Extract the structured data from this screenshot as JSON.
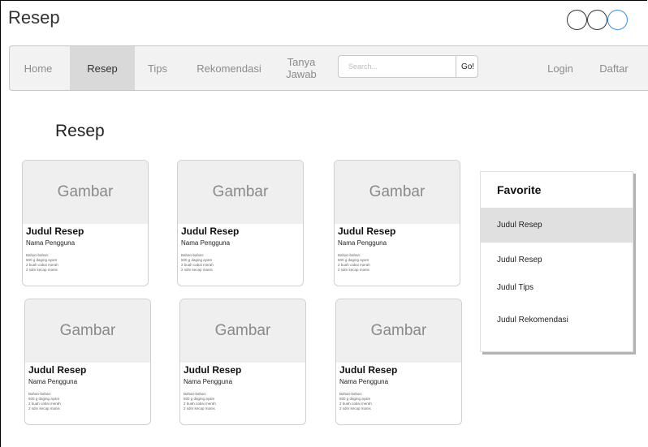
{
  "app": {
    "title": "Resep"
  },
  "nav": {
    "items": [
      {
        "label": "Home"
      },
      {
        "label": "Resep"
      },
      {
        "label": "Tips"
      },
      {
        "label": "Rekomendasi"
      },
      {
        "label": "Tanya\nJawab"
      },
      {
        "label": "Login"
      },
      {
        "label": "Daftar"
      }
    ],
    "active": "Resep",
    "search_placeholder": "Search...",
    "go_label": "Go!"
  },
  "page": {
    "heading": "Resep"
  },
  "cards": [
    {
      "image_label": "Gambar",
      "title": "Judul Resep",
      "user": "Nama Pengguna",
      "ingredients": "Bahan-bahan:\n500 g daging ayam\n2 buah cabai merah\n2 sdm kecap manis"
    },
    {
      "image_label": "Gambar",
      "title": "Judul Resep",
      "user": "Nama Pengguna",
      "ingredients": "Bahan-bahan:\n500 g daging ayam\n2 buah cabai merah\n2 sdm kecap manis"
    },
    {
      "image_label": "Gambar",
      "title": "Judul Resep",
      "user": "Nama Pengguna",
      "ingredients": "Bahan-bahan:\n500 g daging ayam\n2 buah cabai merah\n2 sdm kecap manis"
    },
    {
      "image_label": "Gambar",
      "title": "Judul Resep",
      "user": "Nama Pengguna",
      "ingredients": "Bahan-bahan:\n500 g daging ayam\n2 buah cabai merah\n2 sdm kecap manis"
    },
    {
      "image_label": "Gambar",
      "title": "Judul Resep",
      "user": "Nama Pengguna",
      "ingredients": "Bahan-bahan:\n500 g daging ayam\n2 buah cabai merah\n2 sdm kecap manis"
    },
    {
      "image_label": "Gambar",
      "title": "Judul Resep",
      "user": "Nama Pengguna",
      "ingredients": "Bahan-bahan:\n500 g daging ayam\n2 buah cabai merah\n2 sdm kecap manis"
    }
  ],
  "favorite": {
    "title": "Favorite",
    "items": [
      {
        "label": "Judul Resep"
      },
      {
        "label": "Judul Resep"
      },
      {
        "label": "Judul Tips"
      },
      {
        "label": "Judul Rekomendasi"
      }
    ]
  },
  "colors": {
    "navbar_bg": "#f2f2f2",
    "nav_active_bg": "#d9d9d9",
    "card_image_bg": "#efefef",
    "window_button_accent": "#3a8ee6"
  }
}
